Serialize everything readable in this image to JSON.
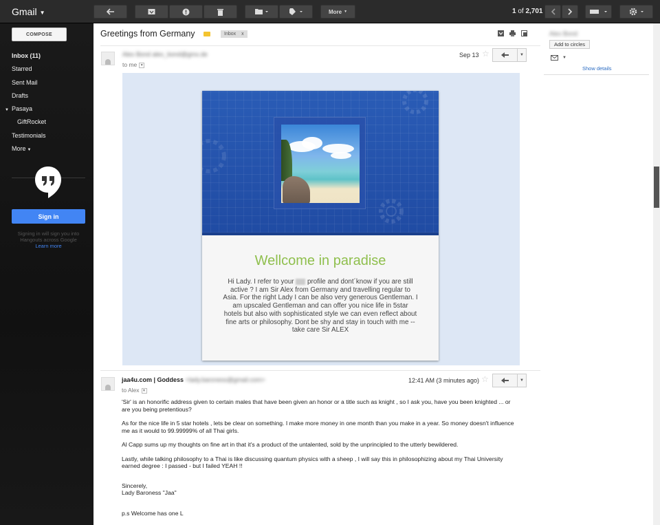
{
  "app": {
    "title": "Gmail"
  },
  "toolbar": {
    "more_label": "More",
    "pager_range": "1",
    "pager_of": "of",
    "pager_total": "2,701"
  },
  "sidebar": {
    "compose_label": "COMPOSE",
    "items": [
      {
        "label": "Inbox (11)"
      },
      {
        "label": "Starred"
      },
      {
        "label": "Sent Mail"
      },
      {
        "label": "Drafts"
      },
      {
        "label": "Pasaya"
      },
      {
        "label": "GiftRocket"
      },
      {
        "label": "Testimonials"
      },
      {
        "label": "More"
      }
    ],
    "signin_label": "Sign in",
    "signin_info": "Signing in will sign you into Hangouts across Google",
    "learn_more": "Learn more"
  },
  "thread": {
    "subject": "Greetings from Germany",
    "label_chip": "Inbox",
    "label_chip_close": "x"
  },
  "msg1": {
    "sender_name": "Alex Bond",
    "sender_email": "alex_bond@gmx.de",
    "to_line": "to me",
    "date": "Sep 13",
    "card_title": "Wellcome in paradise",
    "card_text_1": "Hi Lady. I refer to your",
    "card_text_2": "profile and dont´know if you are still active ? I am Sir Alex from Germany and travelling regular to Asia.  For the right Lady I can be also very generous Gentleman. I am upscaled Gentleman and can offer you nice life in 5star hotels but also with sophisticated style we can even reflect about fine arts or philosophy. Dont be shy and stay in touch with me -- take care Sir ALEX"
  },
  "msg2": {
    "sender_name": "jaa4u.com | Goddess",
    "sender_email": "<lady.baroness@gmail.com>",
    "to_line": "to Alex",
    "date": "12:41 AM (3 minutes ago)",
    "paragraphs": [
      "'Sir' is an honorific address given to certain males that have been given an honor or a title such as knight , so I ask you, have you been knighted ... or are you being pretentious?",
      "As for the nice life in 5 star hotels , lets be clear on something.  I make more money in one month than you make in a year.  So money doesn't influence me as it would to 99.99999% of all Thai girls.",
      "Al Capp sums up my thoughts on fine art in that it's a product of the untalented, sold by the unprincipled to the utterly bewildered.",
      "Lastly, while talking philosophy to a Thai is like discussing quantum physics with a sheep , I will say this in philosophizing about my Thai University earned degree :  I passed - but I failed YEAH !!"
    ],
    "signoff_1": "Sincerely,",
    "signoff_2": "Lady Baroness \"Jaa\"",
    "ps": "p.s   Welcome has one L"
  },
  "contact": {
    "name": "Alex Bond",
    "add_label": "Add to circles",
    "show_details": "Show details"
  }
}
